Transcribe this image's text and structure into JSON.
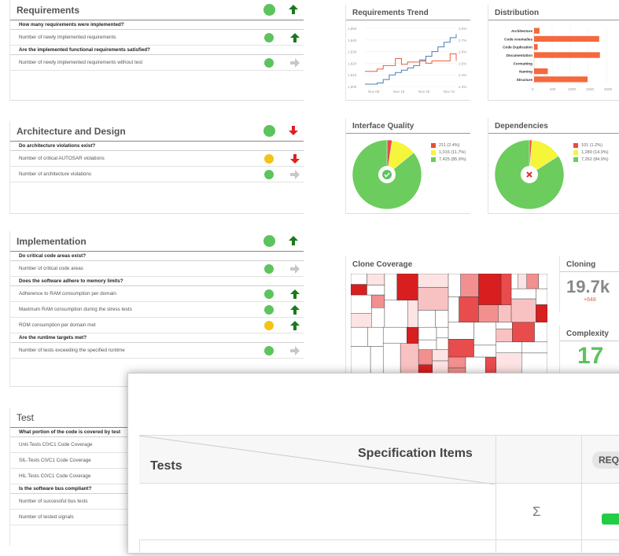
{
  "requirements": {
    "title": "Requirements",
    "rows": [
      {
        "type": "q",
        "text": "How many requirements were implemented?"
      },
      {
        "type": "m",
        "text": "Number of newly implemented requirements",
        "status": "green",
        "trend": "up"
      },
      {
        "type": "q",
        "text": "Are the implemented functional requirements satisfied?"
      },
      {
        "type": "m",
        "text": "Number of newly implemented requirements without test",
        "status": "green",
        "trend": "right"
      }
    ]
  },
  "architecture": {
    "title": "Architecture and Design",
    "rows": [
      {
        "type": "q",
        "text": "Do architecture violations exist?"
      },
      {
        "type": "m",
        "text": "Number of critical AUTOSAR violations",
        "status": "yellow",
        "trend": "down"
      },
      {
        "type": "m",
        "text": "Number of architecture violations",
        "status": "green",
        "trend": "right"
      }
    ]
  },
  "implementation": {
    "title": "Implementation",
    "rows": [
      {
        "type": "q",
        "text": "Do critical code areas exist?"
      },
      {
        "type": "m",
        "text": "Number of critical code areas",
        "status": "green",
        "trend": "right"
      },
      {
        "type": "q",
        "text": "Does the software adhere to memory limits?"
      },
      {
        "type": "m",
        "text": "Adherence to RAM consumption per domain",
        "status": "green",
        "trend": "up"
      },
      {
        "type": "m",
        "text": "Maximum RAM consumption during the stress tests",
        "status": "green",
        "trend": "up"
      },
      {
        "type": "m",
        "text": "ROM consumption per domain met",
        "status": "yellow",
        "trend": "up"
      },
      {
        "type": "q",
        "text": "Are the runtime targets met?"
      },
      {
        "type": "m",
        "text": "Number of tests exceeding the specified runtime",
        "status": "green",
        "trend": "right"
      }
    ]
  },
  "test": {
    "title": "Test",
    "rows": [
      {
        "type": "q",
        "text": "What portion of the code is covered by test"
      },
      {
        "type": "m",
        "text": "Unit-Tests C0/C1 Code Coverage"
      },
      {
        "type": "m",
        "text": "SIL-Tests C0/C1 Code Coverage"
      },
      {
        "type": "m",
        "text": "HIL Tests C0/C1 Code Coverage"
      },
      {
        "type": "q",
        "text": "Is the software bus compliant?"
      },
      {
        "type": "m",
        "text": "Number of successful bus tests"
      },
      {
        "type": "m",
        "text": "Number of tested signals"
      }
    ]
  },
  "requirements_trend": {
    "title": "Requirements Trend",
    "chart_data": {
      "type": "line",
      "y_ticks": [
        "1,850",
        "1,840",
        "1,830",
        "1,820",
        "1,810",
        "1,800"
      ],
      "y2_ticks": [
        "2.8%",
        "2.7%",
        "2.6%",
        "2.5%",
        "2.4%",
        "2.3%"
      ],
      "x_ticks": [
        "Nov 08",
        "Nov 15",
        "Nov 25",
        "Dec 01"
      ],
      "series": [
        {
          "color": "#4a7fb5",
          "values": [
            1802,
            1802,
            1803,
            1806,
            1810,
            1812,
            1814,
            1816,
            1818,
            1822,
            1826,
            1830,
            1834,
            1838,
            1842,
            1845
          ]
        },
        {
          "color": "#e8603c",
          "values": [
            1813,
            1813,
            1815,
            1818,
            1818,
            1824,
            1819,
            1821,
            1821,
            1823,
            1820,
            1822,
            1822,
            1822,
            1828,
            1822
          ]
        }
      ],
      "ylim": [
        1800,
        1850
      ]
    }
  },
  "distribution": {
    "title": "Distribution",
    "chart_data": {
      "type": "bar",
      "categories": [
        "Architecture",
        "Code Anomalies",
        "Code Duplication",
        "Documentation",
        "Formatting",
        "Naming",
        "Structure"
      ],
      "values": [
        150,
        1800,
        100,
        1820,
        0,
        380,
        1480
      ],
      "x_ticks": [
        "0",
        "500",
        "1000",
        "1500",
        "2000"
      ],
      "xlim": [
        0,
        2000
      ],
      "color": "#f4693d"
    }
  },
  "interface_quality": {
    "title": "Interface Quality",
    "chart_data": {
      "type": "pie",
      "labels": [
        "211 (2.4%)",
        "1,016 (11.7%)",
        "7,425 (85.9%)"
      ],
      "values": [
        2.4,
        11.7,
        85.9
      ],
      "colors": [
        "#e84c3d",
        "#f5f53a",
        "#6ccc5e"
      ]
    }
  },
  "dependencies": {
    "title": "Dependencies",
    "chart_data": {
      "type": "pie",
      "labels": [
        "101 (1.2%)",
        "1,289 (14.9%)",
        "7,262 (84.9%)"
      ],
      "values": [
        1.2,
        14.9,
        84.9
      ],
      "colors": [
        "#e84c3d",
        "#f5f53a",
        "#6ccc5e"
      ]
    }
  },
  "clone_coverage": {
    "title": "Clone Coverage"
  },
  "cloning": {
    "title": "Cloning",
    "value": "19.7k",
    "delta": "+648"
  },
  "complexity": {
    "title": "Complexity",
    "value": "17"
  },
  "tests_table": {
    "row_header": "Tests",
    "col_header": "Specification Items",
    "sum_symbol": "Σ",
    "pill": "REQ"
  },
  "colors": {
    "green": "#5dc35d",
    "yellow": "#f2c417",
    "red": "#e02020",
    "up": "#1a7a1a",
    "grey": "#c8c8c8"
  }
}
